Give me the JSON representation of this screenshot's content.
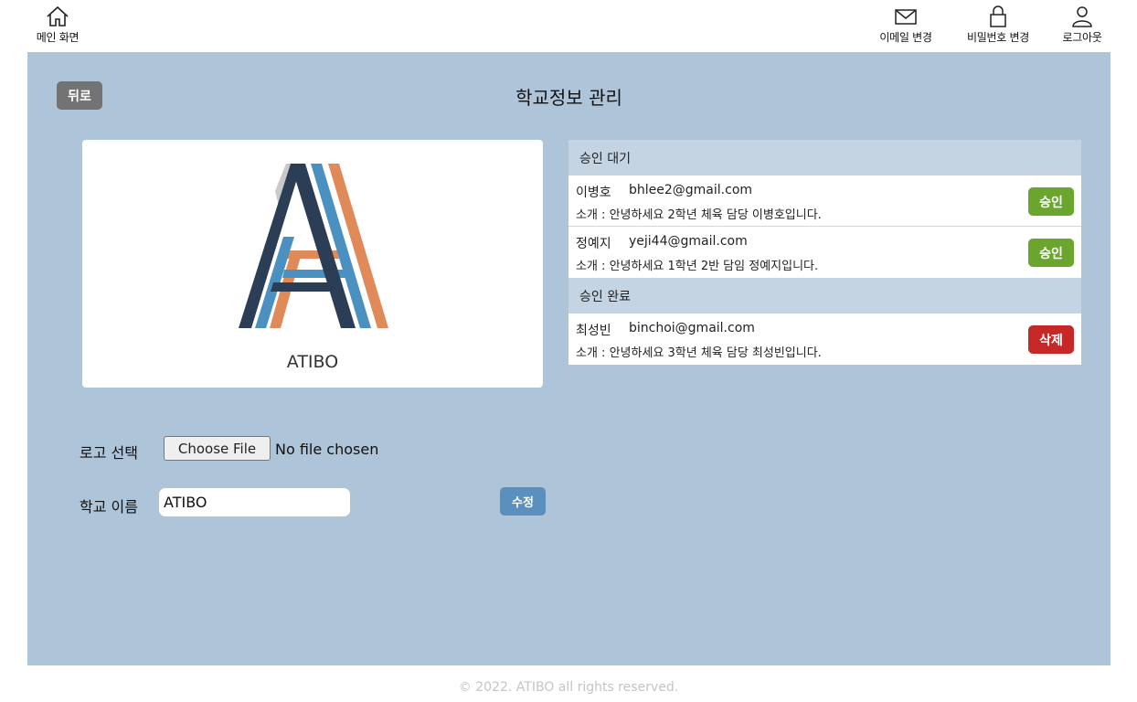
{
  "nav": {
    "home_label": "메인 화면",
    "email_label": "이메일 변경",
    "password_label": "비밀번호 변경",
    "logout_label": "로그아웃"
  },
  "page": {
    "back_label": "뒤로",
    "title": "학교정보 관리"
  },
  "logo_card": {
    "school_name": "ATIBO",
    "logo_colors": {
      "navy": "#2c3e56",
      "blue": "#4a90c0",
      "orange": "#e08a5a",
      "gray": "#c9c9c9"
    }
  },
  "approval": {
    "pending_header": "승인 대기",
    "completed_header": "승인 완료",
    "pending": [
      {
        "name": "이병호",
        "email": "bhlee2@gmail.com",
        "intro": "소개 : 안녕하세요 2학년 체육 담당 이병호입니다.",
        "action": "승인"
      },
      {
        "name": "정예지",
        "email": "yeji44@gmail.com",
        "intro": "소개 : 안녕하세요 1학년 2반 담임 정예지입니다.",
        "action": "승인"
      }
    ],
    "completed": [
      {
        "name": "최성빈",
        "email": "binchoi@gmail.com",
        "intro": "소개 : 안녕하세요 3학년 체육 담당 최성빈입니다.",
        "action": "삭제"
      }
    ]
  },
  "form": {
    "logo_label": "로고 선택",
    "file_button": "Choose File",
    "file_status": "No file chosen",
    "name_label": "학교 이름",
    "name_value": "ATIBO",
    "edit_button": "수정"
  },
  "footer": {
    "copyright": "© 2022. ATIBO all rights reserved."
  },
  "colors": {
    "panel_bg": "#adc4d9",
    "section_header_bg": "#c4d4e3",
    "approve_green": "#6aa62e",
    "delete_red": "#c62828",
    "edit_blue": "#5b8fbd",
    "back_gray": "#737373"
  }
}
